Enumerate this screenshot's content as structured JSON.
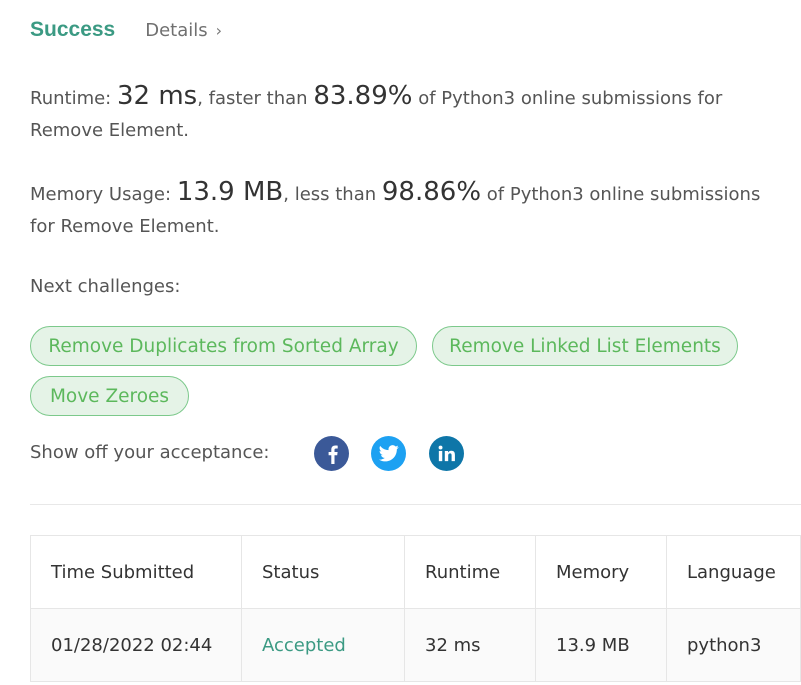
{
  "header": {
    "status": "Success",
    "details_label": "Details",
    "details_chevron": "›"
  },
  "runtime": {
    "label": "Runtime:",
    "value": "32 ms",
    "comparison": ", faster than",
    "percent": "83.89%",
    "suffix": "of Python3 online submissions for Remove Element."
  },
  "memory": {
    "label": "Memory Usage:",
    "value": "13.9 MB",
    "comparison": ", less than",
    "percent": "98.86%",
    "suffix": "of Python3 online submissions for Remove Element."
  },
  "next_challenges": {
    "label": "Next challenges:",
    "items": [
      "Remove Duplicates from Sorted Array",
      "Remove Linked List Elements",
      "Move Zeroes"
    ]
  },
  "share": {
    "label": "Show off your acceptance:",
    "icons": [
      "facebook-icon",
      "twitter-icon",
      "linkedin-icon"
    ]
  },
  "table": {
    "headers": [
      "Time Submitted",
      "Status",
      "Runtime",
      "Memory",
      "Language"
    ],
    "rows": [
      [
        "01/28/2022 02:44",
        "Accepted",
        "32 ms",
        "13.9 MB",
        "python3"
      ]
    ]
  },
  "colors": {
    "success": "#3b9a83",
    "pill_text": "#5cb85c",
    "pill_bg": "#e5f3e7",
    "facebook": "#3b5998",
    "twitter": "#1da1f2",
    "linkedin": "#0e76a8"
  }
}
